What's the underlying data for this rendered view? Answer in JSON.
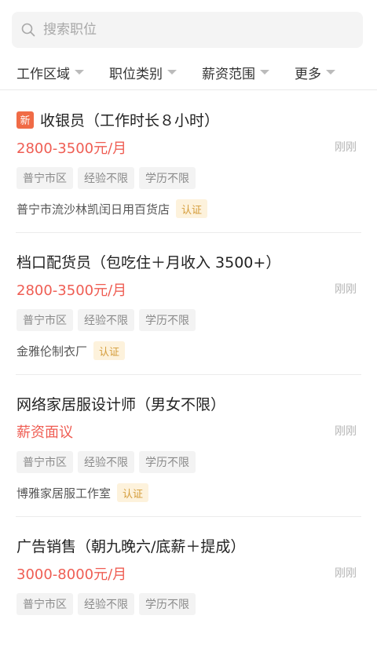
{
  "search": {
    "placeholder": "搜索职位"
  },
  "filters": [
    {
      "label": "工作区域"
    },
    {
      "label": "职位类别"
    },
    {
      "label": "薪资范围"
    },
    {
      "label": "更多"
    }
  ],
  "jobs": [
    {
      "badge": "新",
      "title": "收银员（工作时长８小时）",
      "salary": "2800-3500元/月",
      "time": "刚刚",
      "tags": [
        "普宁市区",
        "经验不限",
        "学历不限"
      ],
      "company": "普宁市流沙林凯闰日用百货店",
      "cert": "认证"
    },
    {
      "title": "档口配货员（包吃住＋月收入 3500+）",
      "salary": "2800-3500元/月",
      "time": "刚刚",
      "tags": [
        "普宁市区",
        "经验不限",
        "学历不限"
      ],
      "company": "金雅伦制衣厂",
      "cert": "认证"
    },
    {
      "title": "网络家居服设计师（男女不限）",
      "salary": "薪资面议",
      "time": "刚刚",
      "tags": [
        "普宁市区",
        "经验不限",
        "学历不限"
      ],
      "company": "博雅家居服工作室",
      "cert": "认证"
    },
    {
      "title": "广告销售（朝九晚六/底薪＋提成）",
      "salary": "3000-8000元/月",
      "time": "刚刚",
      "tags": [
        "普宁市区",
        "经验不限",
        "学历不限"
      ]
    }
  ]
}
